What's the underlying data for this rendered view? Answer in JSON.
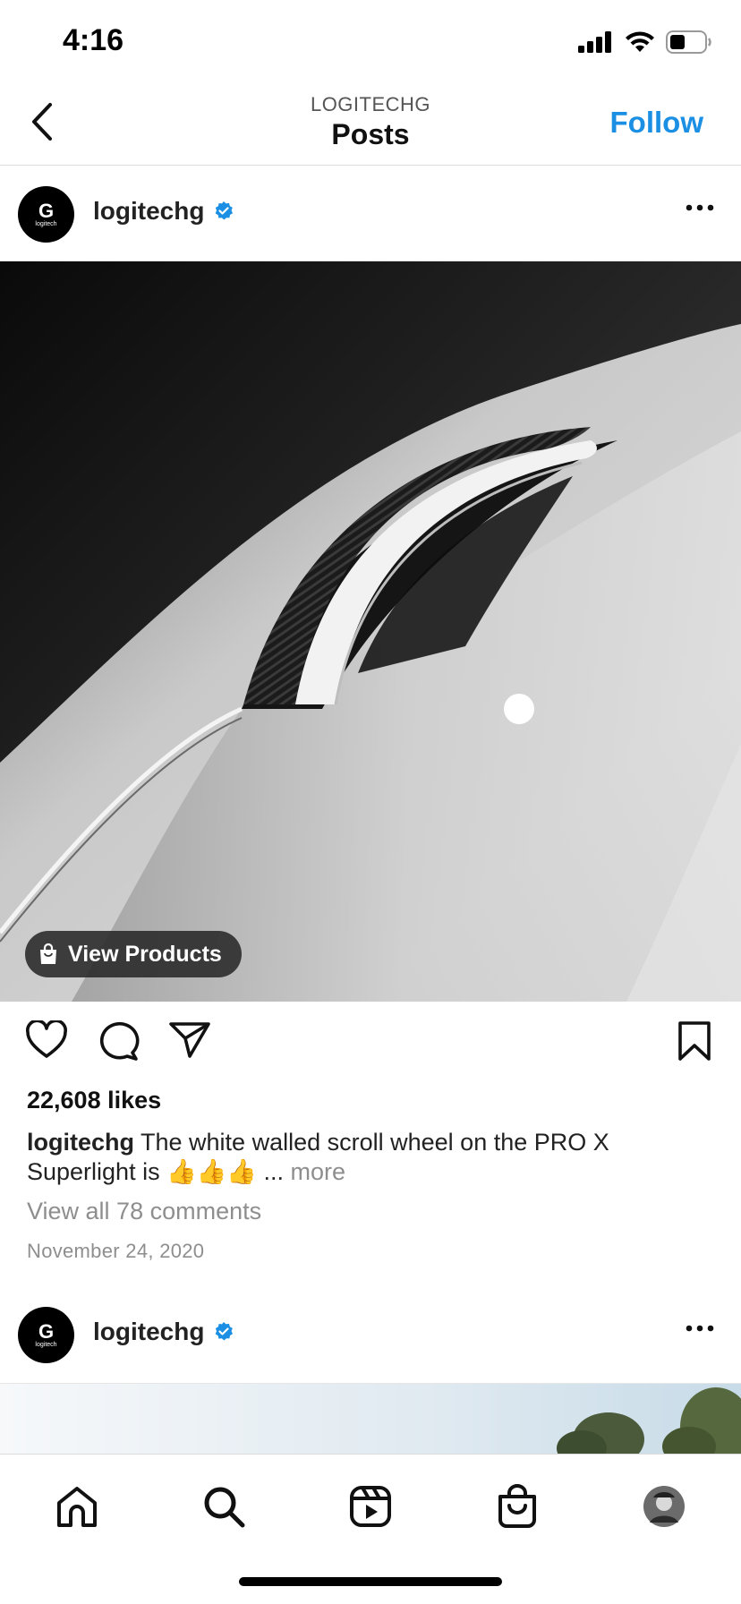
{
  "status_bar": {
    "time": "4:16"
  },
  "nav": {
    "subtitle": "LOGITECHG",
    "title": "Posts",
    "follow_label": "Follow"
  },
  "post": {
    "username": "logitechg",
    "avatar_mark": "G",
    "avatar_word": "logitech",
    "view_products_label": "View Products",
    "likes": "22,608 likes",
    "caption_user": "logitechg",
    "caption_text": "The white walled scroll wheel on the PRO X Superlight is 👍👍👍",
    "caption_more_ellipsis": "...",
    "caption_more": "more",
    "view_comments": "View all 78 comments",
    "date": "November 24, 2020"
  },
  "next_post": {
    "username": "logitechg",
    "avatar_mark": "G",
    "avatar_word": "logitech"
  },
  "colors": {
    "accent": "#1a8fe3",
    "verified": "#1a8fe3",
    "muted": "#8e8e8e"
  },
  "icons": {
    "back": "chevron-left-icon",
    "like": "heart-icon",
    "comment": "comment-bubble-icon",
    "share": "paper-plane-icon",
    "save": "bookmark-icon",
    "tabs": [
      "home-icon",
      "search-icon",
      "reels-icon",
      "shop-bag-icon",
      "profile-avatar"
    ]
  }
}
